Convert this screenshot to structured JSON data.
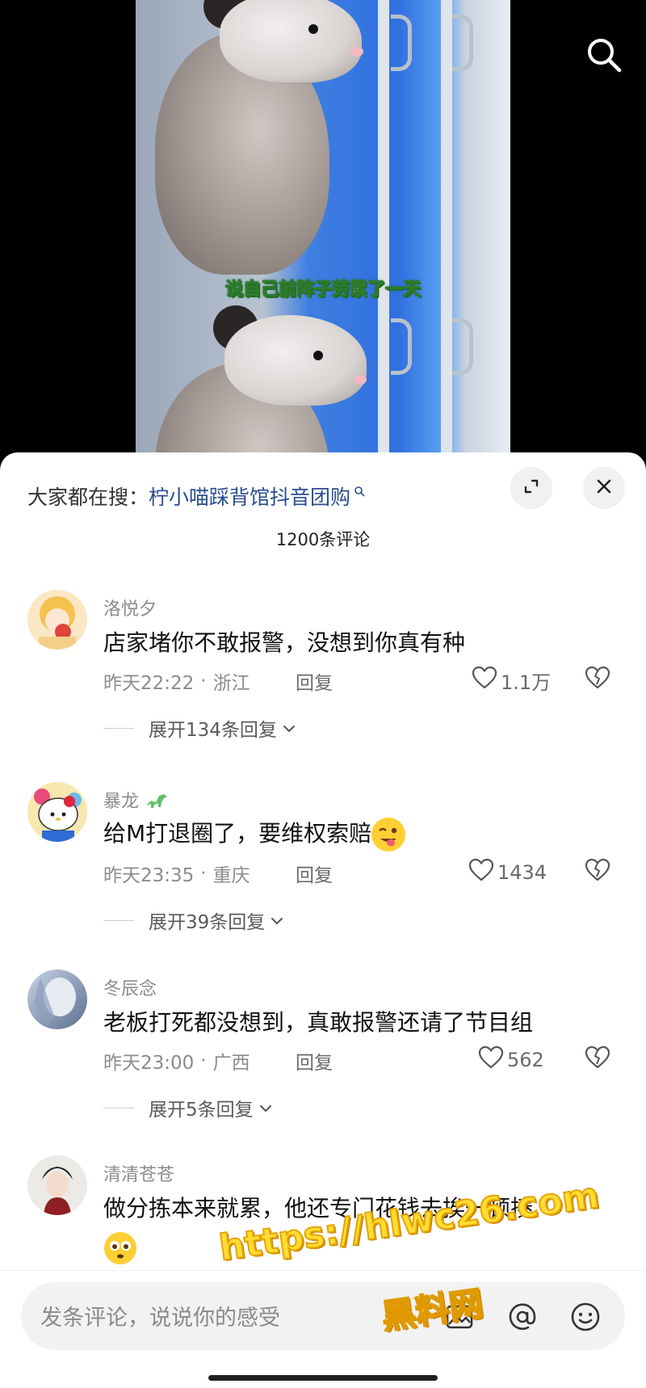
{
  "video": {
    "subtitle": "说自己前阵子劳累了一天"
  },
  "panel": {
    "search_prefix": "大家都在搜：",
    "search_term": "柠小喵踩背馆抖音团购",
    "comment_count": "1200条评论"
  },
  "comments": [
    {
      "username": "洛悦夕",
      "text": "店家堵你不敢报警，没想到你真有种",
      "time": "昨天22:22",
      "location": "浙江",
      "reply_label": "回复",
      "likes": "1.1万",
      "expand_label": "展开134条回复"
    },
    {
      "username": "暴龙",
      "text": "给M打退圈了，要维权索赔",
      "time": "昨天23:35",
      "location": "重庆",
      "reply_label": "回复",
      "likes": "1434",
      "expand_label": "展开39条回复"
    },
    {
      "username": "冬辰念",
      "text": "老板打死都没想到，真敢报警还请了节目组",
      "time": "昨天23:00",
      "location": "广西",
      "reply_label": "回复",
      "likes": "562",
      "expand_label": "展开5条回复"
    },
    {
      "username": "清清苍苍",
      "text": "做分拣本来就累，他还专门花钱去挨一顿揍"
    }
  ],
  "input": {
    "placeholder": "发条评论，说说你的感受"
  },
  "watermark": {
    "url": "https://hlwc26.com",
    "name": "黑料网"
  },
  "colors": {
    "search_term": "#2a4d8f",
    "meta_gray": "#8c8c8c",
    "watermark_yellow": "#ffdd33"
  }
}
